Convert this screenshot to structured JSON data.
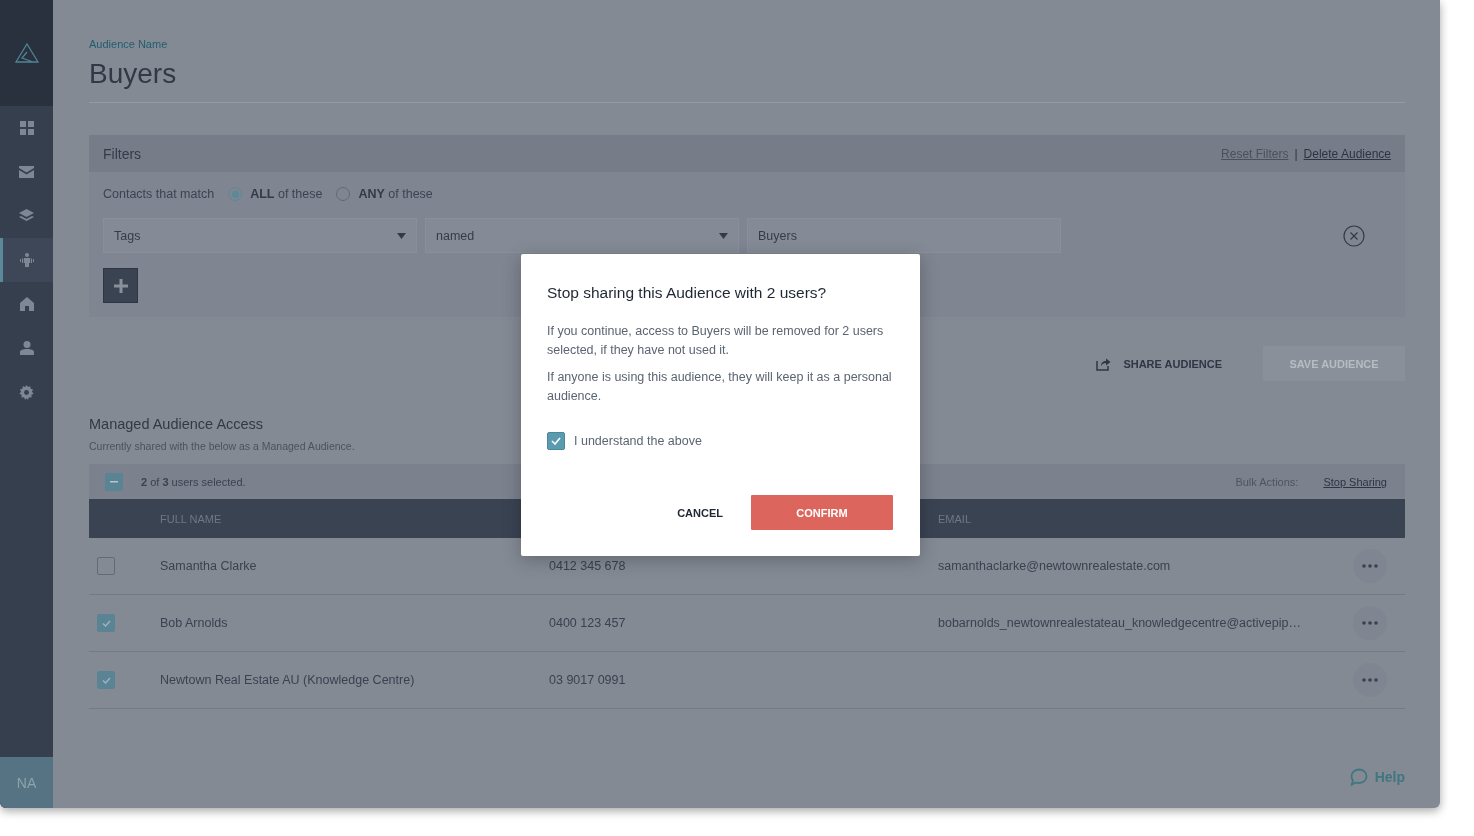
{
  "sidebar": {
    "items": [
      {
        "selected": false
      },
      {
        "selected": false
      },
      {
        "selected": false
      },
      {
        "selected": true
      },
      {
        "selected": false
      },
      {
        "selected": false
      },
      {
        "selected": false
      }
    ],
    "user_initials": "NA"
  },
  "header": {
    "label": "Audience Name",
    "title": "Buyers"
  },
  "filters": {
    "title": "Filters",
    "links": [
      {
        "label": "Reset Filters",
        "disabled": true
      },
      {
        "label": "Delete Audience",
        "disabled": false
      }
    ],
    "separator": "|",
    "match_label": "Contacts that match",
    "match_options": [
      {
        "label": "**ALL** of these",
        "selected": true
      },
      {
        "label": "**ANY** of these",
        "selected": false
      }
    ],
    "rule": {
      "field": "Tags",
      "operator": "named",
      "value": "Buyers"
    }
  },
  "actions": [
    {
      "label": "SHARE AUDIENCE",
      "disabled": false
    },
    {
      "label": "SAVE AUDIENCE",
      "disabled": true
    }
  ],
  "access": {
    "title": "Managed Audience Access",
    "subtitle": "Currently shared with the below as a Managed Audience.",
    "select_all_indeterminate": true,
    "selection_text": "**2** of **3** users selected.",
    "bulk_label": "Bulk Actions:",
    "bulk_action": "Stop Sharing",
    "columns": {
      "full_name": "FULL NAME",
      "email": "EMAIL"
    },
    "rows": [
      {
        "name": "Samantha Clarke",
        "phone": "0412 345 678",
        "email": "samanthaclarke@newtownrealestate.com",
        "selected": false
      },
      {
        "name": "Bob Arnolds",
        "phone": "0400 123 457",
        "email": "bobarnolds_newtownrealestateau_knowledgecentre@activepip…",
        "selected": true
      },
      {
        "name": "Newtown Real Estate AU (Knowledge Centre)",
        "phone": "03 9017 0991",
        "selected": true
      }
    ]
  },
  "dialog": {
    "title": "Stop sharing this Audience with 2 users?",
    "paragraphs": [
      "If you continue, access to Buyers will be removed for 2 users selected, if they have not used it.",
      "If anyone is using this audience, they will keep it as a personal audience."
    ],
    "checkbox": {
      "label": "I understand the above",
      "checked": true
    },
    "buttons": [
      {
        "label": "CANCEL",
        "kind": "text"
      },
      {
        "label": "CONFIRM",
        "kind": "primary"
      }
    ]
  },
  "help": "Help"
}
